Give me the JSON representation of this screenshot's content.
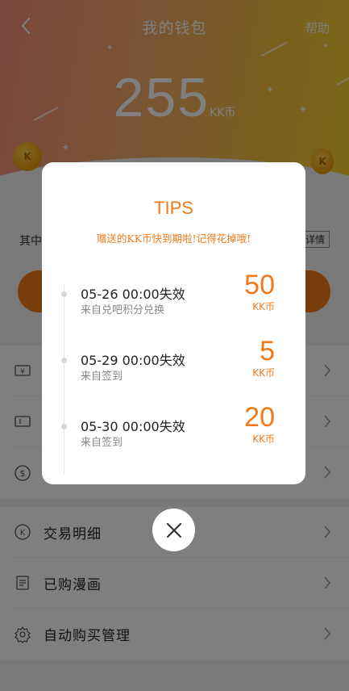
{
  "header": {
    "title": "我的钱包",
    "help": "帮助",
    "balance": "255",
    "balance_unit": "KK币"
  },
  "info": {
    "left_text": "其中",
    "detail_button": "详情"
  },
  "menu_top": [
    {
      "icon": "ticket-yen-icon",
      "label": ""
    },
    {
      "icon": "coupon-icon",
      "label": ""
    },
    {
      "icon": "dollar-circle-icon",
      "label": ""
    }
  ],
  "menu_bottom": [
    {
      "icon": "kk-coin-icon",
      "label": "交易明细"
    },
    {
      "icon": "document-icon",
      "label": "已购漫画"
    },
    {
      "icon": "gear-icon",
      "label": "自动购买管理"
    }
  ],
  "dialog": {
    "title": "TIPS",
    "subtitle": "赠送的KK币快到期啦!记得花掉哦!",
    "entries": [
      {
        "date": "05-26 00:00失效",
        "source": "来自兑吧积分兑换",
        "amount": "50",
        "unit": "KK币"
      },
      {
        "date": "05-29 00:00失效",
        "source": "来自签到",
        "amount": "5",
        "unit": "KK币"
      },
      {
        "date": "05-30 00:00失效",
        "source": "来自签到",
        "amount": "20",
        "unit": "KK币"
      }
    ]
  },
  "colors": {
    "accent": "#f07a1a",
    "overlay": "rgba(0,0,0,0.5)"
  }
}
